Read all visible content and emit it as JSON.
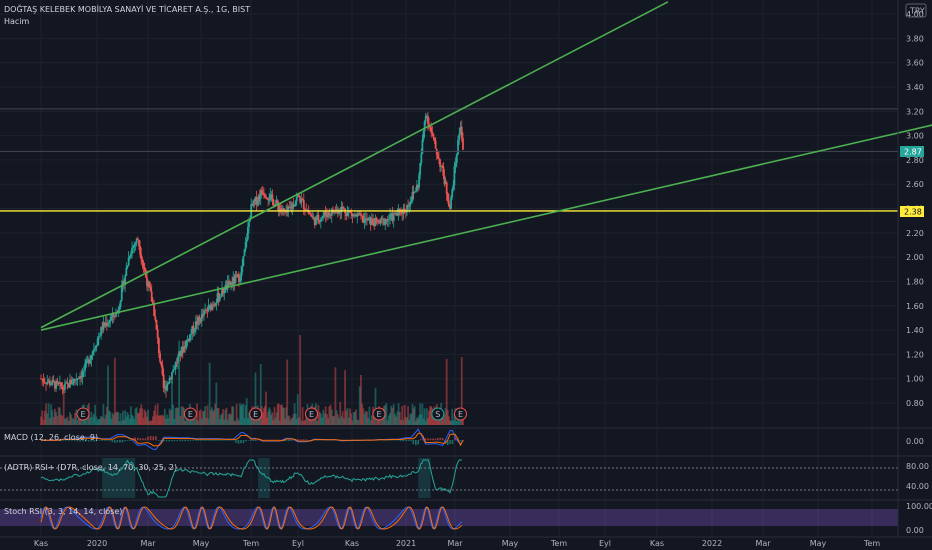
{
  "header": {
    "symbol_line": "DOĞTAŞ KELEBEK MOBİLYA SANAYİ VE TİCARET A.Ş., 1G, BIST",
    "volume_label": "Hacim",
    "currency": "TRY"
  },
  "colors": {
    "background": "#131722",
    "grid": "#1e222d",
    "up": "#26a69a",
    "down": "#ef5350",
    "trendline": "#4caf50",
    "support_line": "#ffeb3b",
    "macd_line": "#2962ff",
    "signal_line": "#ff6d00",
    "rsi_line": "#7e57c2",
    "stoch_band": "#7e57c2"
  },
  "panes": {
    "macd_label": "MACD (12, 26, close, 9)",
    "rsi_label": "(ADTR) RSI+ (D7R, close, 14, 70, 30, 25, 2)",
    "stoch_label": "Stoch RSI (3, 3, 14, 14, close)"
  },
  "price_badges": {
    "last": "2.87",
    "level": "2.38"
  },
  "earnings_marker": "E",
  "dividend_marker": "S",
  "chart_data": {
    "type": "candlestick",
    "title": "DOĞTAŞ KELEBEK MOBİLYA SANAYİ VE TİCARET A.Ş., 1G, BIST",
    "currency": "TRY",
    "price_axis": [
      "4.00",
      "3.80",
      "3.60",
      "3.40",
      "3.20",
      "3.00",
      "2.80",
      "2.60",
      "2.40",
      "2.20",
      "2.00",
      "1.80",
      "1.60",
      "1.40",
      "1.20",
      "1.00",
      "0.80"
    ],
    "price_range": [
      0.72,
      4.1
    ],
    "time_axis": [
      "Kas",
      "2020",
      "Mar",
      "May",
      "Tem",
      "Eyl",
      "Kas",
      "2021",
      "Mar",
      "May",
      "Tem",
      "Eyl",
      "Kas",
      "2022",
      "Mar",
      "May",
      "Tem"
    ],
    "time_index_of_ticks": [
      0,
      2,
      4,
      6,
      8,
      10,
      12,
      14,
      16,
      18,
      20,
      22,
      24,
      26,
      28,
      30,
      32
    ],
    "data_end_index": 16.3,
    "price_path": [
      [
        0,
        1.0
      ],
      [
        0.8,
        0.92
      ],
      [
        1.5,
        1.05
      ],
      [
        2.2,
        1.42
      ],
      [
        2.8,
        1.55
      ],
      [
        3.3,
        2.05
      ],
      [
        3.6,
        2.15
      ],
      [
        3.9,
        1.85
      ],
      [
        4.2,
        1.6
      ],
      [
        4.6,
        0.9
      ],
      [
        5.2,
        1.2
      ],
      [
        5.8,
        1.45
      ],
      [
        6.4,
        1.6
      ],
      [
        7.0,
        1.75
      ],
      [
        7.6,
        1.85
      ],
      [
        8.0,
        2.4
      ],
      [
        8.5,
        2.55
      ],
      [
        9.0,
        2.45
      ],
      [
        9.5,
        2.35
      ],
      [
        10.0,
        2.5
      ],
      [
        10.6,
        2.3
      ],
      [
        11.0,
        2.35
      ],
      [
        11.6,
        2.4
      ],
      [
        12.0,
        2.35
      ],
      [
        12.5,
        2.3
      ],
      [
        13.0,
        2.28
      ],
      [
        13.5,
        2.33
      ],
      [
        14.0,
        2.4
      ],
      [
        14.5,
        2.6
      ],
      [
        14.8,
        3.2
      ],
      [
        15.2,
        2.9
      ],
      [
        15.5,
        2.7
      ],
      [
        15.8,
        2.4
      ],
      [
        16.0,
        2.75
      ],
      [
        16.2,
        3.1
      ],
      [
        16.3,
        2.87
      ]
    ],
    "trendlines": [
      {
        "name": "upper",
        "from": [
          0,
          1.42
        ],
        "to": [
          24.4,
          4.1
        ]
      },
      {
        "name": "lower",
        "from": [
          0,
          1.4
        ],
        "to": [
          34.5,
          3.1
        ]
      }
    ],
    "horizontal_levels": [
      2.38,
      2.87,
      3.22
    ],
    "earnings_events_index": [
      1.5,
      5.6,
      8.2,
      10.5,
      13.0,
      15.3,
      16.2
    ],
    "rsi_axis": [
      "80.00",
      "40.00"
    ],
    "rsi_levels": [
      70,
      30
    ],
    "stoch_axis": [
      "100.00",
      "0.00"
    ],
    "macd_axis": [
      "0.00"
    ],
    "grid": true
  }
}
